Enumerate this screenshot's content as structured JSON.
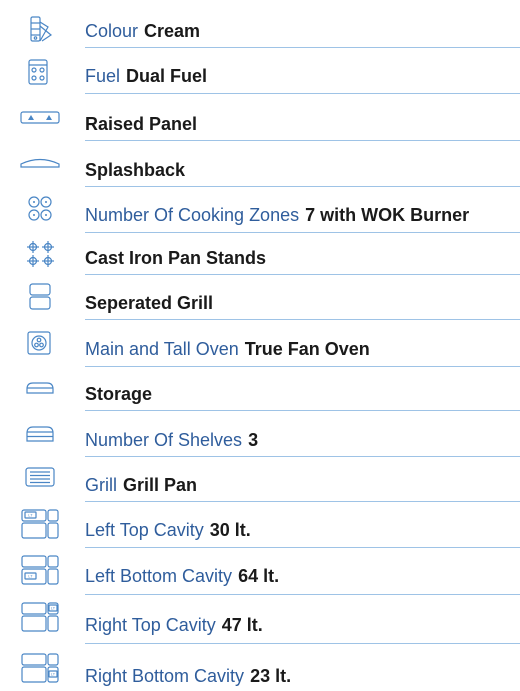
{
  "specs": [
    {
      "icon": "colour-palette-icon",
      "label": "Colour",
      "value": "Cream"
    },
    {
      "icon": "fuel-icon",
      "label": "Fuel",
      "value": "Dual Fuel"
    },
    {
      "icon": "raised-panel-icon",
      "label": "",
      "value": "Raised Panel"
    },
    {
      "icon": "splashback-icon",
      "label": "",
      "value": "Splashback"
    },
    {
      "icon": "cooking-zones-icon",
      "label": "Number Of Cooking Zones",
      "value": "7 with WOK Burner"
    },
    {
      "icon": "pan-stands-icon",
      "label": "",
      "value": "Cast Iron Pan Stands"
    },
    {
      "icon": "separated-grill-icon",
      "label": "",
      "value": "Seperated Grill"
    },
    {
      "icon": "fan-oven-icon",
      "label": "Main and Tall Oven",
      "value": "True Fan Oven"
    },
    {
      "icon": "storage-icon",
      "label": "",
      "value": "Storage"
    },
    {
      "icon": "shelves-icon",
      "label": "Number Of Shelves",
      "value": "3"
    },
    {
      "icon": "grill-pan-icon",
      "label": "Grill",
      "value": "Grill Pan"
    },
    {
      "icon": "left-top-cavity-icon",
      "label": "Left Top Cavity",
      "value": "30 lt."
    },
    {
      "icon": "left-bottom-cavity-icon",
      "label": "Left Bottom Cavity",
      "value": "64 lt."
    },
    {
      "icon": "right-top-cavity-icon",
      "label": "Right Top Cavity",
      "value": "47 lt."
    },
    {
      "icon": "right-bottom-cavity-icon",
      "label": "Right Bottom Cavity",
      "value": "23 lt."
    }
  ],
  "cavity_badge": "LT",
  "colors": {
    "label": "#2f5d9c",
    "value": "#1a1a1a",
    "icon": "#4a86c5",
    "divider": "#9ec3e6"
  }
}
